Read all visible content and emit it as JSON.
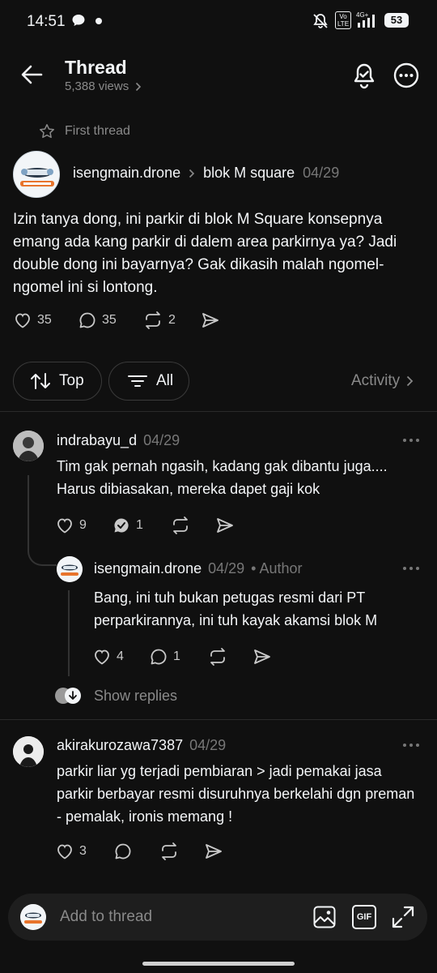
{
  "status_bar": {
    "time": "14:51",
    "battery": "53"
  },
  "header": {
    "title": "Thread",
    "views": "5,388 views"
  },
  "first_thread_label": "First thread",
  "post": {
    "username": "isengmain.drone",
    "topic": "blok M square",
    "date": "04/29",
    "avatar_text": "@isengmain.drone",
    "text": "Izin tanya dong, ini parkir di blok M Square konsepnya emang ada kang parkir di dalem area parkirnya ya? Jadi double dong ini bayarnya? Gak dikasih malah ngomel-ngomel ini si lontong.",
    "likes": "35",
    "comments": "35",
    "reposts": "2"
  },
  "sort_bar": {
    "top_label": "Top",
    "all_label": "All",
    "activity_label": "Activity"
  },
  "replies": [
    {
      "username": "indrabayu_d",
      "date": "04/29",
      "text": "Tim gak pernah ngasih, kadang gak dibantu juga.... Harus dibiasakan, mereka dapet gaji kok",
      "likes": "9",
      "comments": "1"
    },
    {
      "username": "isengmain.drone",
      "date": "04/29",
      "author_tag": "• Author",
      "text": "Bang, ini tuh bukan petugas resmi dari PT perparkirannya, ini tuh kayak akamsi blok M",
      "likes": "4",
      "comments": "1"
    },
    {
      "username": "akirakurozawa7387",
      "date": "04/29",
      "text": "parkir liar yg terjadi pembiaran > jadi pemakai jasa parkir berbayar resmi disuruhnya berkelahi dgn preman - pemalak, ironis memang !",
      "likes": "3"
    }
  ],
  "show_replies_label": "Show replies",
  "composer": {
    "placeholder": "Add to thread",
    "gif_label": "GIF"
  }
}
